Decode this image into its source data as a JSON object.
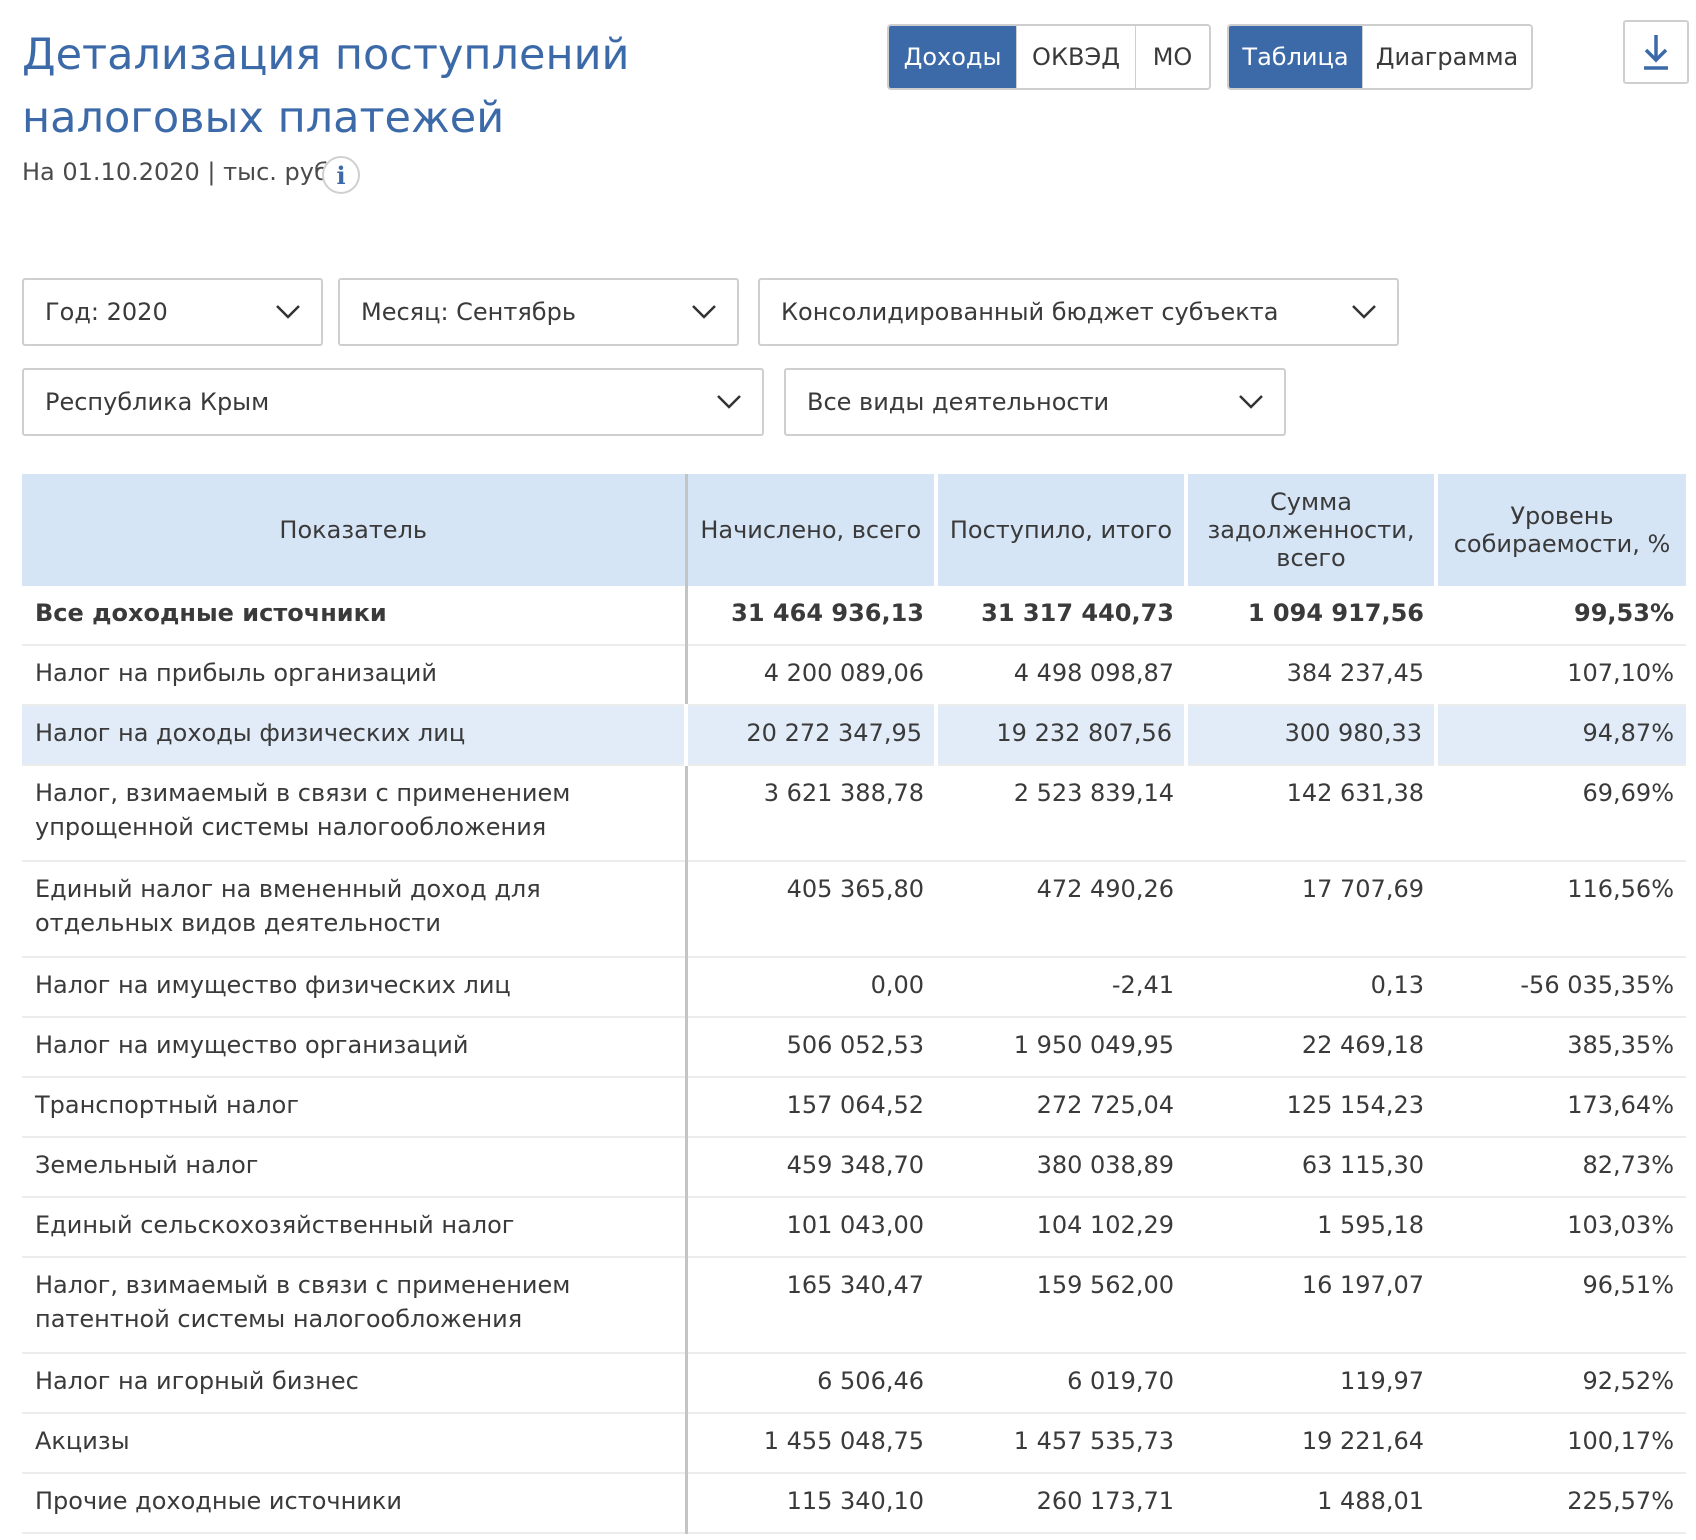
{
  "header": {
    "title": "Детализация поступлений налоговых платежей",
    "subtitle": "На 01.10.2020 | тыс. руб.",
    "info_icon": "info-icon"
  },
  "view_tabs": [
    {
      "label": "Доходы",
      "active": true
    },
    {
      "label": "ОКВЭД",
      "active": false
    },
    {
      "label": "МО",
      "active": false
    }
  ],
  "display_tabs": [
    {
      "label": "Таблица",
      "active": true
    },
    {
      "label": "Диаграмма",
      "active": false
    }
  ],
  "download_icon": "download-icon",
  "filters": {
    "year": "Год: 2020",
    "month": "Месяц: Сентябрь",
    "budget": "Консолидированный бюджет субъекта",
    "region": "Республика Крым",
    "activity": "Все виды деятельности"
  },
  "table": {
    "columns": [
      "Показатель",
      "Начислено, всего",
      "Поступило, итого",
      "Сумма задолженности, всего",
      "Уровень собираемости, %"
    ],
    "rows": [
      {
        "name": "Все доходные источники",
        "accrued": "31 464 936,13",
        "received": "31 317 440,73",
        "debt": "1 094 917,56",
        "rate": "99,53%"
      },
      {
        "name": "Налог на прибыль организаций",
        "accrued": "4 200 089,06",
        "received": "4 498 098,87",
        "debt": "384 237,45",
        "rate": "107,10%"
      },
      {
        "name": "Налог на доходы физических лиц",
        "accrued": "20 272 347,95",
        "received": "19 232 807,56",
        "debt": "300 980,33",
        "rate": "94,87%"
      },
      {
        "name": "Налог, взимаемый в связи с применением упрощенной системы налогообложения",
        "accrued": "3 621 388,78",
        "received": "2 523 839,14",
        "debt": "142 631,38",
        "rate": "69,69%"
      },
      {
        "name": "Единый налог на вмененный доход для отдельных видов деятельности",
        "accrued": "405 365,80",
        "received": "472 490,26",
        "debt": "17 707,69",
        "rate": "116,56%"
      },
      {
        "name": "Налог на имущество физических лиц",
        "accrued": "0,00",
        "received": "-2,41",
        "debt": "0,13",
        "rate": "-56 035,35%"
      },
      {
        "name": "Налог на имущество организаций",
        "accrued": "506 052,53",
        "received": "1 950 049,95",
        "debt": "22 469,18",
        "rate": "385,35%"
      },
      {
        "name": "Транспортный налог",
        "accrued": "157 064,52",
        "received": "272 725,04",
        "debt": "125 154,23",
        "rate": "173,64%"
      },
      {
        "name": "Земельный налог",
        "accrued": "459 348,70",
        "received": "380 038,89",
        "debt": "63 115,30",
        "rate": "82,73%"
      },
      {
        "name": "Единый сельскохозяйственный налог",
        "accrued": "101 043,00",
        "received": "104 102,29",
        "debt": "1 595,18",
        "rate": "103,03%"
      },
      {
        "name": "Налог, взимаемый в связи с применением патентной системы налогообложения",
        "accrued": "165 340,47",
        "received": "159 562,00",
        "debt": "16 197,07",
        "rate": "96,51%"
      },
      {
        "name": "Налог на игорный бизнес",
        "accrued": "6 506,46",
        "received": "6 019,70",
        "debt": "119,97",
        "rate": "92,52%"
      },
      {
        "name": "Акцизы",
        "accrued": "1 455 048,75",
        "received": "1 457 535,73",
        "debt": "19 221,64",
        "rate": "100,17%"
      },
      {
        "name": "Прочие доходные источники",
        "accrued": "115 340,10",
        "received": "260 173,71",
        "debt": "1 488,01",
        "rate": "225,57%"
      }
    ]
  },
  "colors": {
    "accent": "#3c6aa8",
    "header_bg": "#d6e5f6",
    "highlight_row": "#e1ecf8"
  }
}
